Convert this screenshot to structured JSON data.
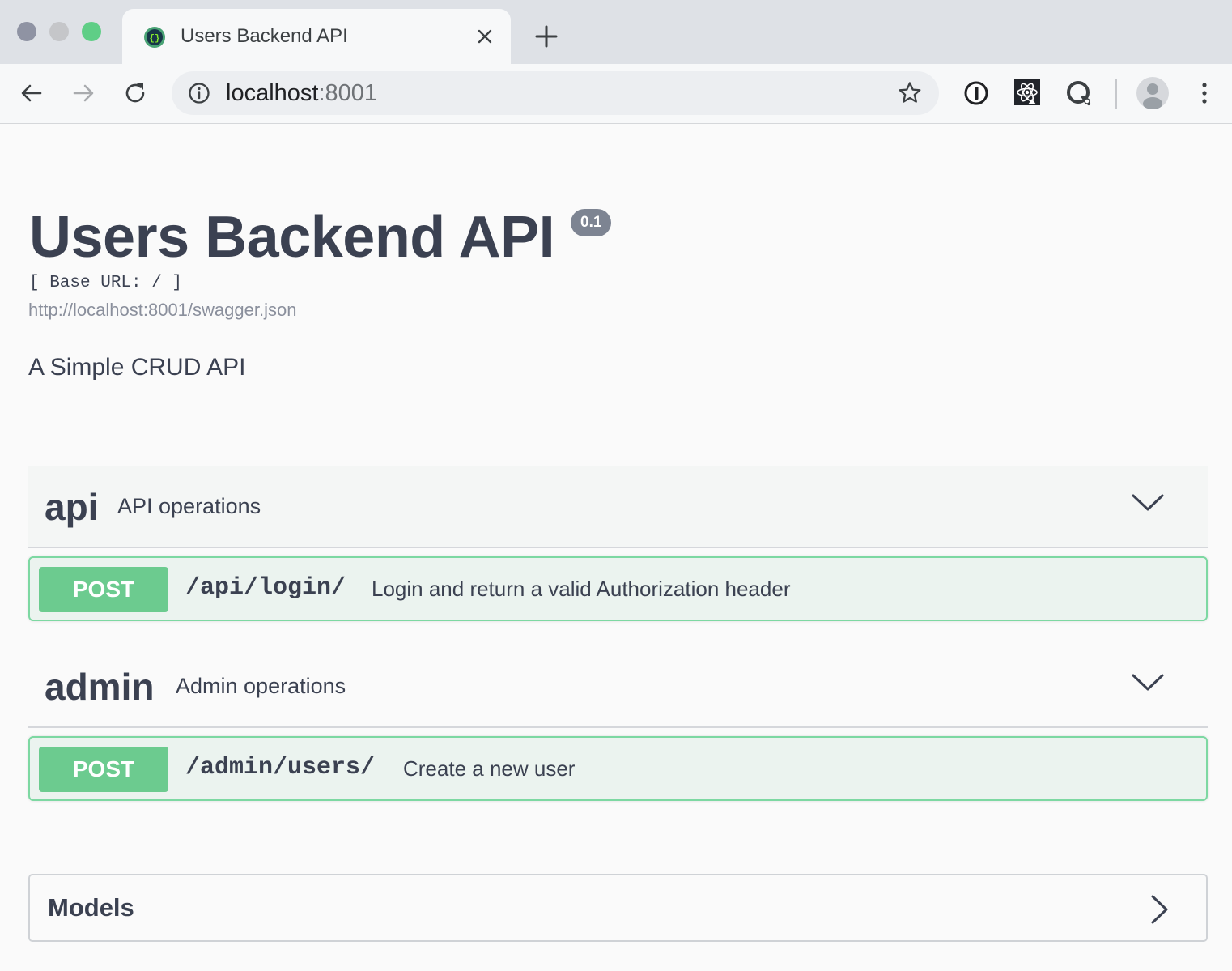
{
  "browser": {
    "tab": {
      "title": "Users Backend API"
    },
    "address": {
      "host": "localhost",
      "port": ":8001"
    }
  },
  "info": {
    "title": "Users Backend API",
    "version": "0.1",
    "base_url": "[ Base URL: / ]",
    "spec_url": "http://localhost:8001/swagger.json",
    "description": "A Simple CRUD API"
  },
  "tags": [
    {
      "name": "api",
      "description": "API operations",
      "operations": [
        {
          "method": "POST",
          "path": "/api/login/",
          "summary": "Login and return a valid Authorization header"
        }
      ]
    },
    {
      "name": "admin",
      "description": "Admin operations",
      "operations": [
        {
          "method": "POST",
          "path": "/admin/users/",
          "summary": "Create a new user"
        }
      ]
    }
  ],
  "models": {
    "title": "Models"
  },
  "colors": {
    "post_method": "#6ccb8f",
    "post_border": "#7dd8a2",
    "post_background": "#ebf3ef",
    "text": "#3b4151"
  },
  "icons": {
    "back": "back-arrow-icon",
    "forward": "forward-arrow-icon",
    "reload": "reload-icon",
    "info": "info-icon",
    "bookmark": "star-icon",
    "extension_1": "password-manager-icon",
    "extension_2": "react-devtools-icon",
    "extension_3": "extension-icon",
    "profile": "avatar-icon",
    "menu": "kebab-menu-icon"
  }
}
